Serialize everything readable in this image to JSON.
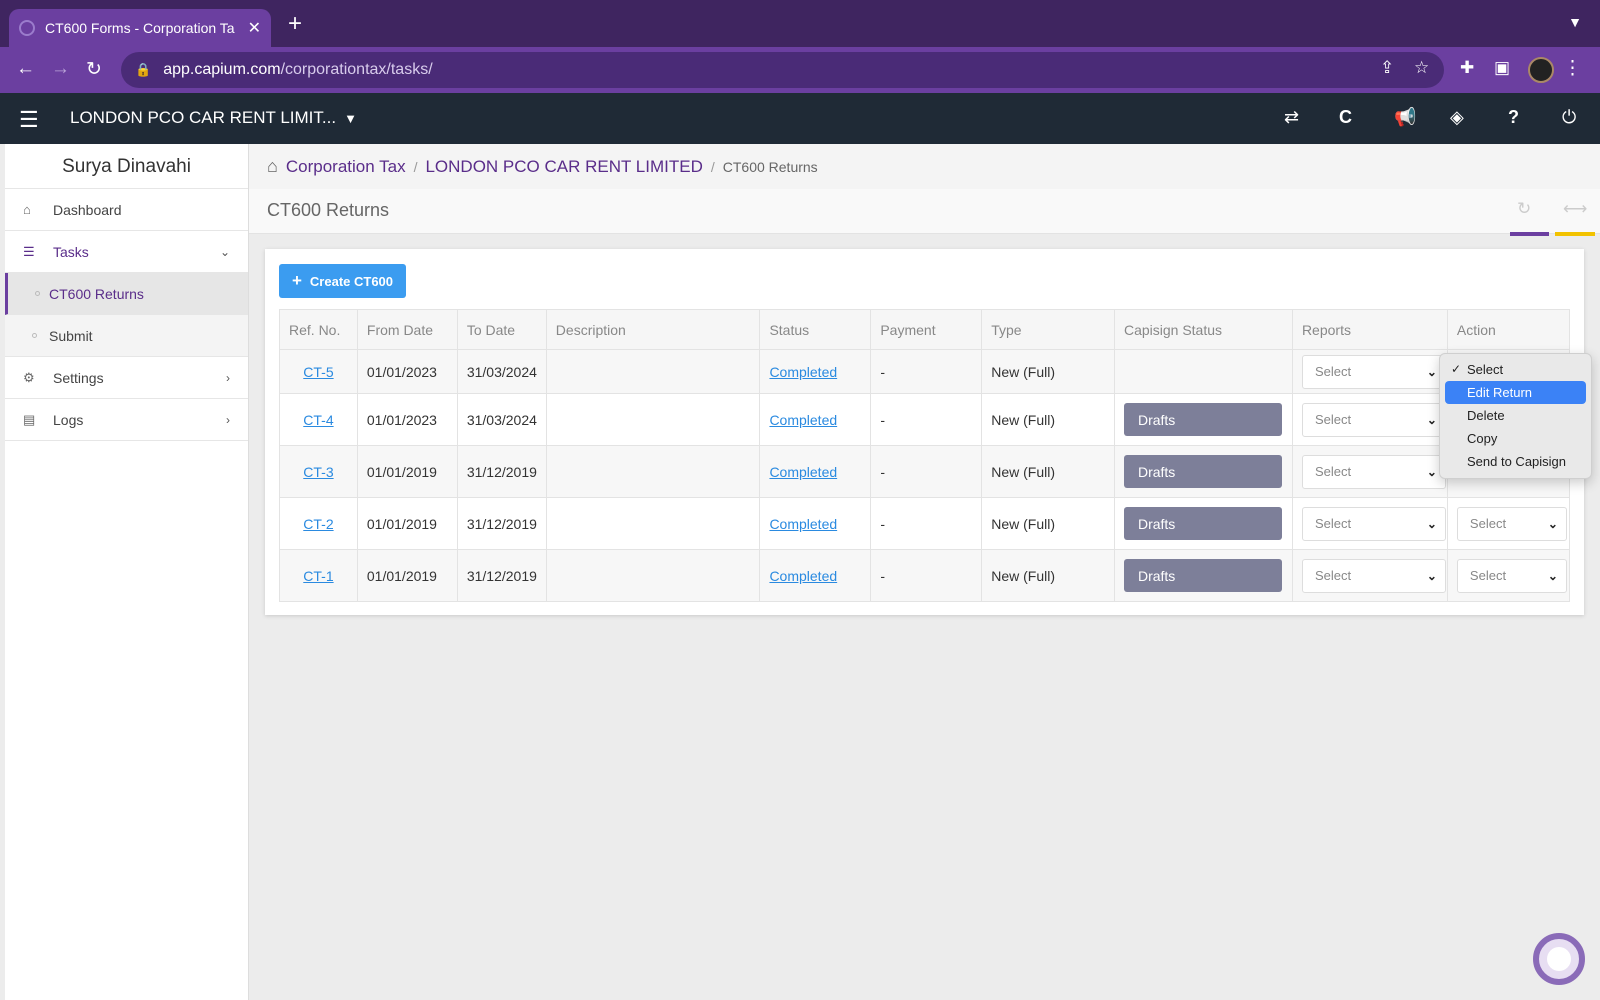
{
  "browser": {
    "tab_title": "CT600 Forms - Corporation Ta",
    "new_tab": "+",
    "url_host": "app.capium.com",
    "url_path": "/corporationtax/tasks/"
  },
  "header": {
    "company": "LONDON PCO CAR RENT LIMIT..."
  },
  "sidebar": {
    "user": "Surya Dinavahi",
    "items": [
      {
        "label": "Dashboard"
      },
      {
        "label": "Tasks"
      },
      {
        "label": "CT600 Returns"
      },
      {
        "label": "Submit"
      },
      {
        "label": "Settings"
      },
      {
        "label": "Logs"
      }
    ]
  },
  "breadcrumb": {
    "root": "Corporation Tax",
    "client": "LONDON PCO CAR RENT LIMITED",
    "current": "CT600 Returns"
  },
  "page": {
    "title": "CT600 Returns",
    "create_label": "Create CT600"
  },
  "table": {
    "headers": [
      "Ref. No.",
      "From Date",
      "To Date",
      "Description",
      "Status",
      "Payment",
      "Type",
      "Capisign Status",
      "Reports",
      "Action"
    ],
    "rows": [
      {
        "ref": "CT-5",
        "from": "01/01/2023",
        "to": "31/03/2024",
        "description": "",
        "status": "Completed",
        "payment": "-",
        "type": "New (Full)",
        "capisign": "",
        "reports": "Select",
        "action": ""
      },
      {
        "ref": "CT-4",
        "from": "01/01/2023",
        "to": "31/03/2024",
        "description": "",
        "status": "Completed",
        "payment": "-",
        "type": "New (Full)",
        "capisign": "Drafts",
        "reports": "Select",
        "action": ""
      },
      {
        "ref": "CT-3",
        "from": "01/01/2019",
        "to": "31/12/2019",
        "description": "",
        "status": "Completed",
        "payment": "-",
        "type": "New (Full)",
        "capisign": "Drafts",
        "reports": "Select",
        "action": ""
      },
      {
        "ref": "CT-2",
        "from": "01/01/2019",
        "to": "31/12/2019",
        "description": "",
        "status": "Completed",
        "payment": "-",
        "type": "New (Full)",
        "capisign": "Drafts",
        "reports": "Select",
        "action": "Select"
      },
      {
        "ref": "CT-1",
        "from": "01/01/2019",
        "to": "31/12/2019",
        "description": "",
        "status": "Completed",
        "payment": "-",
        "type": "New (Full)",
        "capisign": "Drafts",
        "reports": "Select",
        "action": "Select"
      }
    ]
  },
  "action_menu": {
    "options": [
      "Select",
      "Edit Return",
      "Delete",
      "Copy",
      "Send to Capisign"
    ],
    "selected": "Select",
    "highlighted": "Edit Return"
  },
  "colors": {
    "brand_purple": "#6b3fa0",
    "header_dark": "#1f2a36",
    "primary_button": "#3b9cf0",
    "drafts_badge": "#7d7f99",
    "link": "#2a8ae0"
  }
}
